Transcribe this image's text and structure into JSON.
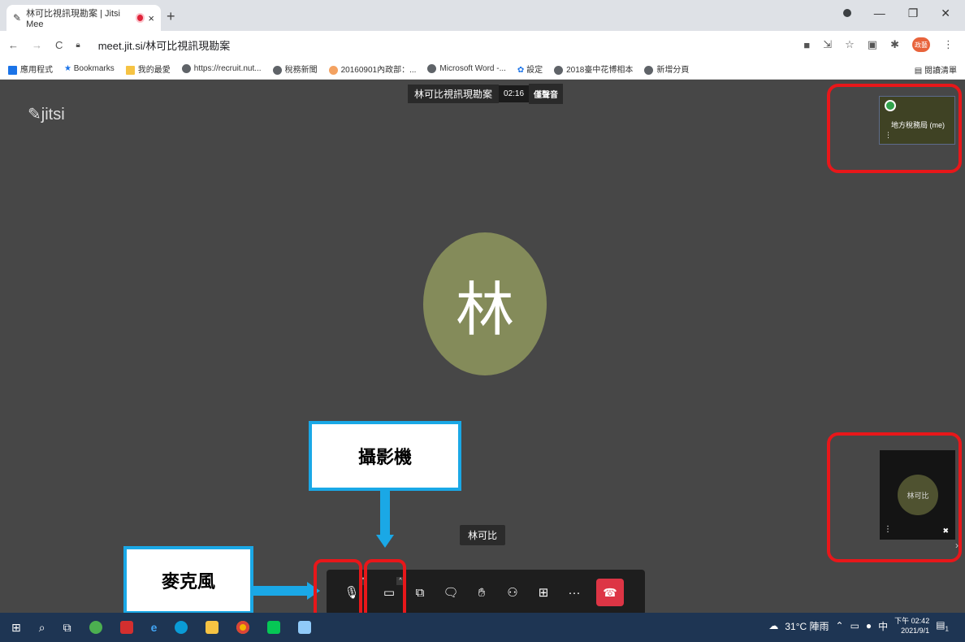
{
  "browser": {
    "tab_title": "林可比視訊現勘案 | Jitsi Mee",
    "tab_close": "×",
    "new_tab": "+",
    "url": "meet.jit.si/林可比視訊現勘案",
    "window_controls": [
      "—",
      "❐",
      "✕"
    ],
    "profile_badge": "政藝"
  },
  "bookmarks": {
    "items": [
      "應用程式",
      "Bookmarks",
      "我的最愛",
      "https://recruit.nut...",
      "稅務新聞",
      "20160901內政部：...",
      "Microsoft Word -...",
      "設定",
      "2018臺中花博相本",
      "新增分頁"
    ],
    "reading_list": "閱讀清單"
  },
  "meeting": {
    "subject": "林可比視訊現勘案",
    "timer": "02:16",
    "audio_only": "僅聲音",
    "logo": "jitsi",
    "speaker_initial": "林",
    "speaker_name": "林可比",
    "self_label": "地方稅務局 (me)",
    "other_initials": "林可比"
  },
  "annotations": {
    "camera_label": "攝影機",
    "mic_label": "麥克風"
  },
  "toolbar": {
    "items": [
      "mic-icon",
      "camera-icon",
      "share-screen-icon",
      "chat-icon",
      "raise-hand-icon",
      "participants-icon",
      "tile-view-icon",
      "more-icon",
      "hangup-icon"
    ],
    "more_label": "···"
  },
  "taskbar": {
    "weather": "31°C 陣雨",
    "ime": "中",
    "time": "下午 02:42",
    "date": "2021/9/1",
    "notifications": "1"
  },
  "colors": {
    "stage_bg": "#474747",
    "avatar_bg": "#848b5a",
    "highlight_red": "#e8171a",
    "highlight_blue": "#1aa8e6",
    "hangup": "#dd3545"
  }
}
